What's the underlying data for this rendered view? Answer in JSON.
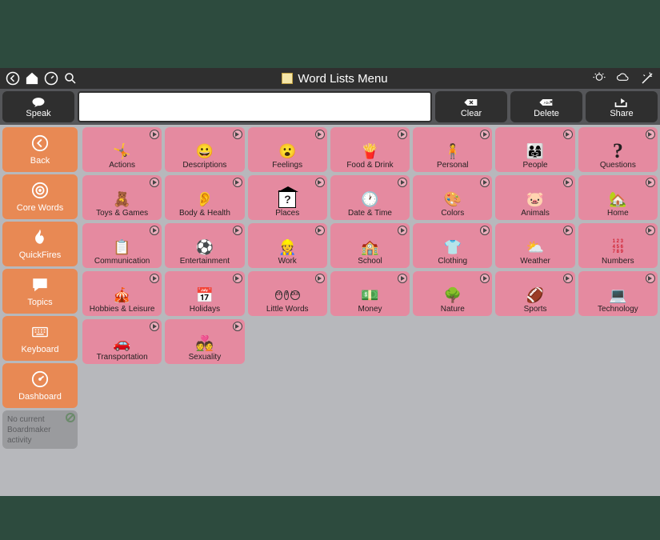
{
  "titlebar": {
    "title": "Word Lists Menu"
  },
  "toolbar": {
    "speak": "Speak",
    "clear": "Clear",
    "delete": "Delete",
    "share": "Share",
    "input_value": ""
  },
  "sidebar": {
    "items": [
      {
        "label": "Back",
        "icon": "back"
      },
      {
        "label": "Core Words",
        "icon": "target"
      },
      {
        "label": "QuickFires",
        "icon": "flame"
      },
      {
        "label": "Topics",
        "icon": "speech"
      },
      {
        "label": "Keyboard",
        "icon": "keyboard"
      },
      {
        "label": "Dashboard",
        "icon": "gauge"
      }
    ],
    "disabled": {
      "line1": "No current",
      "line2": "Boardmaker",
      "line3": "activity"
    }
  },
  "tiles": [
    {
      "label": "Actions",
      "emoji": "🤸"
    },
    {
      "label": "Descriptions",
      "emoji": "😀"
    },
    {
      "label": "Feelings",
      "emoji": "😮"
    },
    {
      "label": "Food & Drink",
      "emoji": "🍟"
    },
    {
      "label": "Personal",
      "emoji": "🧍"
    },
    {
      "label": "People",
      "emoji": "👨‍👩‍👧"
    },
    {
      "label": "Questions",
      "emoji": "?"
    },
    {
      "label": "Toys & Games",
      "emoji": "🧸"
    },
    {
      "label": "Body & Health",
      "emoji": "👂"
    },
    {
      "label": "Places",
      "emoji": "🏠"
    },
    {
      "label": "Date & Time",
      "emoji": "🕐"
    },
    {
      "label": "Colors",
      "emoji": "🎨"
    },
    {
      "label": "Animals",
      "emoji": "🐷"
    },
    {
      "label": "Home",
      "emoji": "🏡"
    },
    {
      "label": "Communication",
      "emoji": "📋"
    },
    {
      "label": "Entertainment",
      "emoji": "⚽"
    },
    {
      "label": "Work",
      "emoji": "👷"
    },
    {
      "label": "School",
      "emoji": "🏫"
    },
    {
      "label": "Clothing",
      "emoji": "👕"
    },
    {
      "label": "Weather",
      "emoji": "⛅"
    },
    {
      "label": "Numbers",
      "emoji": ""
    },
    {
      "label": "Hobbies & Leisure",
      "emoji": "🎪"
    },
    {
      "label": "Holidays",
      "emoji": "📅"
    },
    {
      "label": "Little Words",
      "emoji": ""
    },
    {
      "label": "Money",
      "emoji": "💵"
    },
    {
      "label": "Nature",
      "emoji": "🌳"
    },
    {
      "label": "Sports",
      "emoji": "🏈"
    },
    {
      "label": "Technology",
      "emoji": "💻"
    },
    {
      "label": "Transportation",
      "emoji": "🚗"
    },
    {
      "label": "Sexuality",
      "emoji": "💑"
    }
  ],
  "numbers_tile_text": "1 2 3\n4 5 6\n7 8 9",
  "little_words_text": "on if\nbut"
}
